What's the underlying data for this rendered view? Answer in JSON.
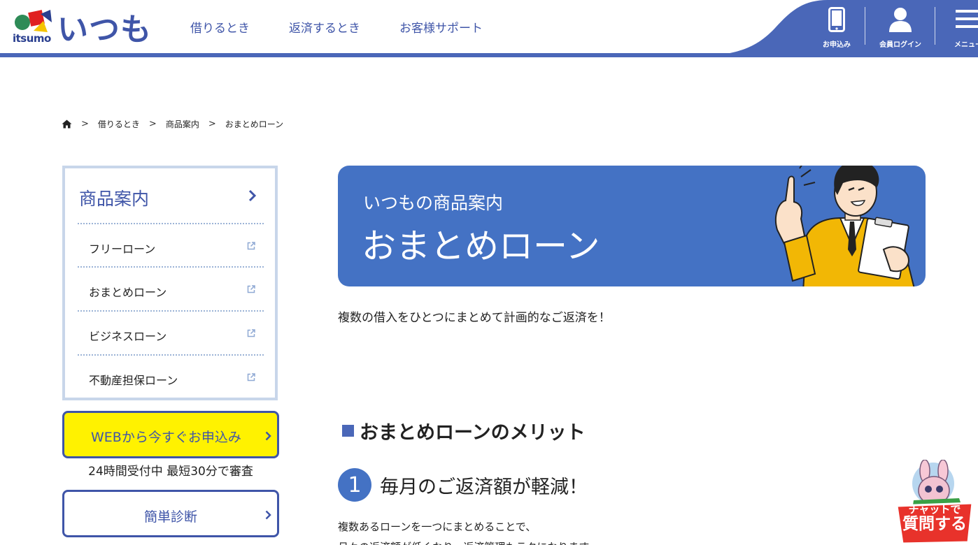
{
  "header": {
    "logo_latin": "itsumo",
    "logo_jp": "いつも",
    "nav": [
      "借りるとき",
      "返済するとき",
      "お客様サポート"
    ],
    "apply_label": "お申込み",
    "login_label": "会員ログイン",
    "menu_label": "メニュー"
  },
  "breadcrumb": {
    "items": [
      "借りるとき",
      "商品案内",
      "おまとめローン"
    ]
  },
  "sidebar": {
    "title": "商品案内",
    "items": [
      {
        "label": "フリーローン"
      },
      {
        "label": "おまとめローン"
      },
      {
        "label": "ビジネスローン"
      },
      {
        "label": "不動産担保ローン"
      }
    ],
    "apply_button": "WEBから今すぐお申込み",
    "apply_note": "24時間受付中 最短30分で審査",
    "diagnosis_button": "簡単診断"
  },
  "hero": {
    "subtitle": "いつもの商品案内",
    "title": "おまとめローン"
  },
  "main": {
    "lead": "複数の借入をひとつにまとめて計画的なご返済を！",
    "section_title": "おまとめローンのメリット",
    "point_number": "1",
    "point_title": "毎月のご返済額が軽減！",
    "body_line1": "複数あるローンを一つにまとめることで、",
    "body_line2": "月々の返済額が低くなり、返済管理もラクになります。"
  },
  "chat": {
    "line1": "チャットで",
    "line2": "質問する"
  },
  "colors": {
    "brand_blue": "#4a67b8",
    "hero_blue": "#4472c4",
    "apply_yellow": "#fff200",
    "side_border": "#c8d6ea"
  }
}
